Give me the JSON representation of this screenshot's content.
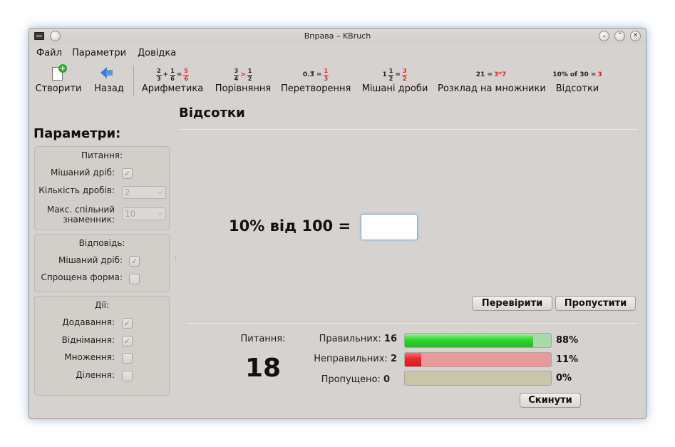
{
  "window": {
    "title": "Вправа – KBruch"
  },
  "menu": {
    "items": [
      "Файл",
      "Параметри",
      "Довідка"
    ]
  },
  "toolbar": {
    "new_label": "Створити",
    "back_label": "Назад",
    "arith_label": "Арифметика",
    "compare_label": "Порівняння",
    "convert_label": "Перетворення",
    "mixed_label": "Мішані дроби",
    "factor_label": "Розклад на множники",
    "percent_label": "Відсотки",
    "factor_icon": {
      "lhs": "21 = ",
      "rhs": "3*7"
    },
    "percent_icon": {
      "lhs": "10% of 30 = ",
      "rhs": "3"
    }
  },
  "section": {
    "title": "Відсотки"
  },
  "params": {
    "title": "Параметри:",
    "question_group": {
      "title": "Питання:",
      "mixed_label": "Мішаний дріб:",
      "mixed_checked": true,
      "count_label": "Кількість дробів:",
      "count_value": "2",
      "maxdenom_label_1": "Макс. спільний",
      "maxdenom_label_2": "знаменник:",
      "maxdenom_value": "10"
    },
    "answer_group": {
      "title": "Відповідь:",
      "mixed_label": "Мішаний дріб:",
      "mixed_checked": true,
      "reduced_label": "Спрощена форма:",
      "reduced_checked": false
    },
    "ops_group": {
      "title": "Дії:",
      "add_label": "Додавання:",
      "add_checked": true,
      "sub_label": "Віднімання:",
      "sub_checked": true,
      "mul_label": "Множення:",
      "mul_checked": false,
      "div_label": "Ділення:",
      "div_checked": false
    }
  },
  "exercise": {
    "question": "10% від 100 =",
    "answer_value": "",
    "check_label": "Перевірити",
    "skip_label": "Пропустити"
  },
  "stats": {
    "questions_label": "Питання:",
    "questions_count": "18",
    "correct_label": "Правильних:",
    "correct_count": "16",
    "correct_pct": "88%",
    "correct_fraction": 0.88,
    "wrong_label": "Неправильних:",
    "wrong_count": "2",
    "wrong_pct": "11%",
    "wrong_fraction": 0.11,
    "skipped_label": "Пропущено:",
    "skipped_count": "0",
    "skipped_pct": "0%",
    "skipped_fraction": 0,
    "reset_label": "Скинути"
  },
  "colors": {
    "correct": "#2fd62f",
    "wrong": "#e8292b",
    "wrong_bg": "#e79a97",
    "skipped_bg": "#c9c6a7",
    "focus": "#7fa9d8"
  }
}
